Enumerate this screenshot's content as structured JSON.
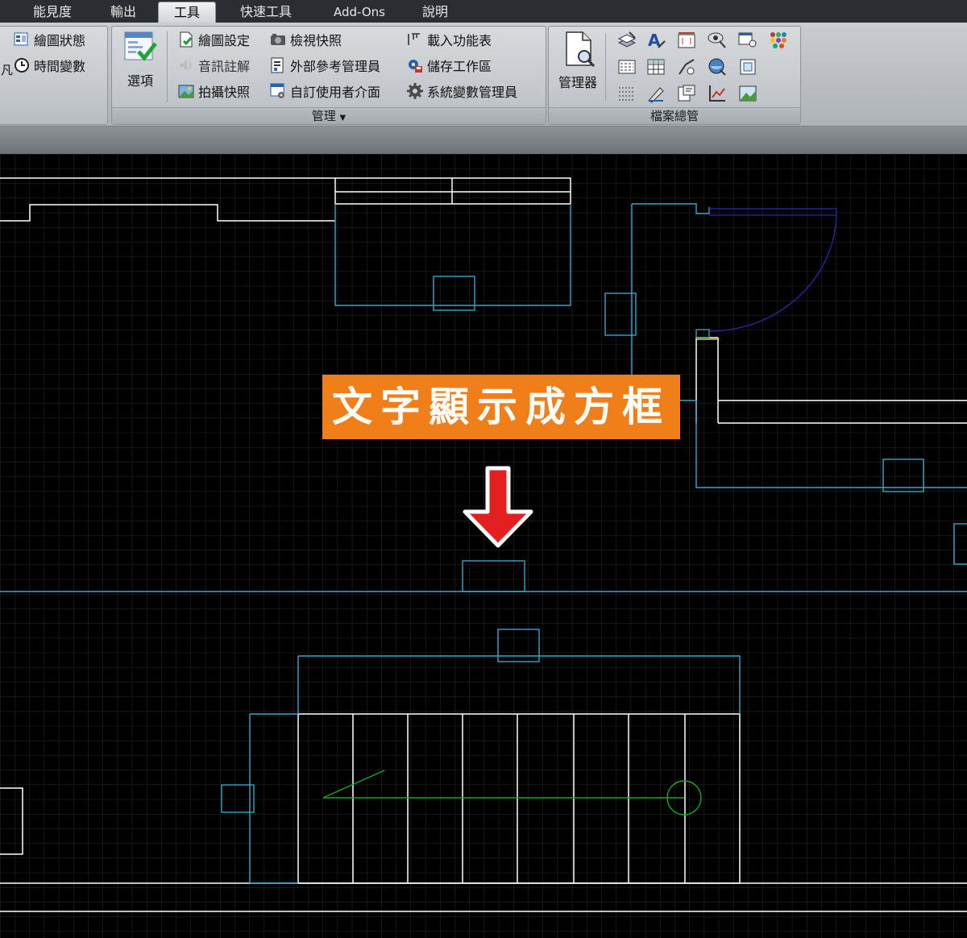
{
  "tabs": [
    {
      "label": "能見度",
      "active": false
    },
    {
      "label": "輸出",
      "active": false
    },
    {
      "label": "工具",
      "active": true
    },
    {
      "label": "快速工具",
      "active": false
    },
    {
      "label": "Add-Ons",
      "active": false
    },
    {
      "label": "說明",
      "active": false
    }
  ],
  "panel_left": {
    "items": [
      {
        "label": "繪圖狀態",
        "icon": "drawing-status-icon"
      },
      {
        "label": "時間變數",
        "icon": "clock-icon"
      }
    ],
    "edge_glyph": "凡"
  },
  "panel_manage": {
    "title": "管理",
    "title_has_dropdown": true,
    "options_label": "選項",
    "items": [
      {
        "label": "繪圖設定",
        "icon": "drawing-settings-icon"
      },
      {
        "label": "音訊註解",
        "icon": "audio-note-icon"
      },
      {
        "label": "拍攝快照",
        "icon": "take-snapshot-icon"
      },
      {
        "label": "檢視快照",
        "icon": "view-snapshot-icon"
      },
      {
        "label": "外部參考管理員",
        "icon": "xref-manager-icon"
      },
      {
        "label": "自訂使用者介面",
        "icon": "customize-ui-icon"
      },
      {
        "label": "載入功能表",
        "icon": "load-menu-icon"
      },
      {
        "label": "儲存工作區",
        "icon": "save-workspace-icon"
      },
      {
        "label": "系統變數管理員",
        "icon": "sysvar-manager-icon"
      }
    ]
  },
  "panel_files": {
    "title": "檔案總管",
    "manager_label": "管理器",
    "icons": [
      "layer-tool-icon",
      "text-style-icon",
      "dimension-style-icon",
      "view-manager-icon",
      "named-view-icon",
      "block-palette-icon",
      "linetype-icon",
      "table-style-icon",
      "multileader-icon",
      "visual-style-icon",
      "ucs-icon",
      "hatch-pattern-icon",
      "pen-edit-icon",
      "layout-icon",
      "chart-icon",
      "image-icon"
    ]
  },
  "callout": {
    "text": "文字顯示成方框",
    "arrow": "down-arrow-icon",
    "colors": {
      "fill": "#f07f1a",
      "arrow": "#e41f1f",
      "text": "#ffffff"
    }
  },
  "cad": {
    "colors": {
      "background": "#000000",
      "grid": "#2b2b2b",
      "wall": "#ffffff",
      "cyan": "#3aa6c9",
      "door_arc": "#2a2aa8",
      "green": "#1aa52a",
      "yellow": "#d8d02a"
    }
  }
}
